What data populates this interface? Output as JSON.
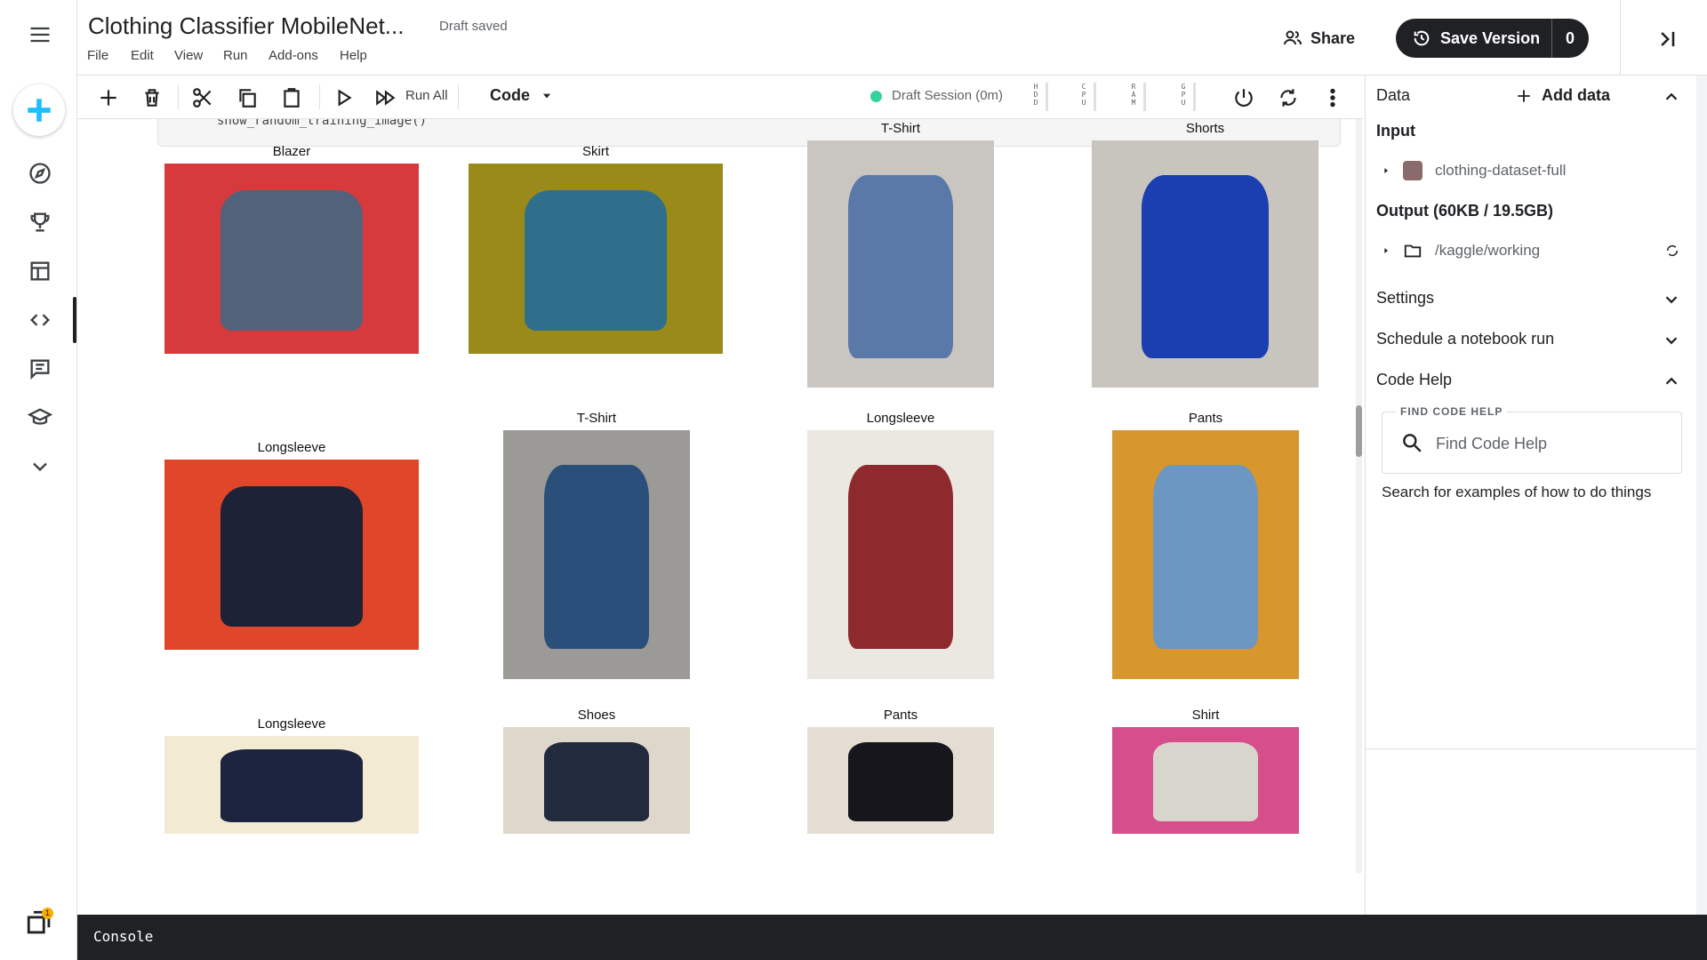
{
  "header": {
    "title": "Clothing Classifier MobileNet...",
    "status": "Draft saved",
    "menu": [
      "File",
      "Edit",
      "View",
      "Run",
      "Add-ons",
      "Help"
    ],
    "share_label": "Share",
    "save_version_label": "Save Version",
    "save_version_count": "0"
  },
  "toolbar": {
    "run_all_label": "Run All",
    "cell_type": "Code",
    "session_label": "Draft Session (0m)",
    "gauges": [
      "HDD",
      "CPU",
      "RAM",
      "GPU"
    ]
  },
  "notebook": {
    "code_tail": "show_random_training_image()",
    "images": [
      {
        "label": "Blazer",
        "colors": [
          "#d63a3d",
          "#52627a"
        ]
      },
      {
        "label": "Skirt",
        "colors": [
          "#9a8a1a",
          "#2f6f8c"
        ]
      },
      {
        "label": "T-Shirt",
        "colors": [
          "#c9c5c0",
          "#5a78a8"
        ]
      },
      {
        "label": "Shorts",
        "colors": [
          "#c8c4be",
          "#1b3fb0"
        ]
      },
      {
        "label": "Longsleeve",
        "colors": [
          "#e0462a",
          "#1e2236"
        ]
      },
      {
        "label": "T-Shirt",
        "colors": [
          "#9c9a96",
          "#2a4f7a"
        ]
      },
      {
        "label": "Longsleeve",
        "colors": [
          "#ebe7e1",
          "#8e2a2e"
        ]
      },
      {
        "label": "Pants",
        "colors": [
          "#d7962e",
          "#6c97c2"
        ]
      },
      {
        "label": "Longsleeve",
        "colors": [
          "#f2ead2",
          "#1c2440"
        ]
      },
      {
        "label": "Shoes",
        "colors": [
          "#ded8cc",
          "#222a3e"
        ]
      },
      {
        "label": "Pants",
        "colors": [
          "#e3ddd3",
          "#16161c"
        ]
      },
      {
        "label": "Shirt",
        "colors": [
          "#d64e8c",
          "#d8d6cc"
        ]
      }
    ]
  },
  "right_panel": {
    "data_title": "Data",
    "add_data_label": "Add data",
    "input_label": "Input",
    "input_dataset": "clothing-dataset-full",
    "output_label": "Output (60KB / 19.5GB)",
    "output_path": "/kaggle/working",
    "settings_label": "Settings",
    "schedule_label": "Schedule a notebook run",
    "code_help_label": "Code Help",
    "find_legend": "FIND CODE HELP",
    "find_placeholder": "Find Code Help",
    "find_hint": "Search for examples of how to do things"
  },
  "console": {
    "label": "Console"
  },
  "rail": {
    "items": [
      "create",
      "compass",
      "trophy",
      "table",
      "code",
      "comments",
      "learn",
      "more"
    ],
    "bottom_badge": "1"
  },
  "colors": {
    "accent": "#20beff",
    "session": "#34d399",
    "dark": "#202124",
    "badge": "#f9ab00"
  }
}
